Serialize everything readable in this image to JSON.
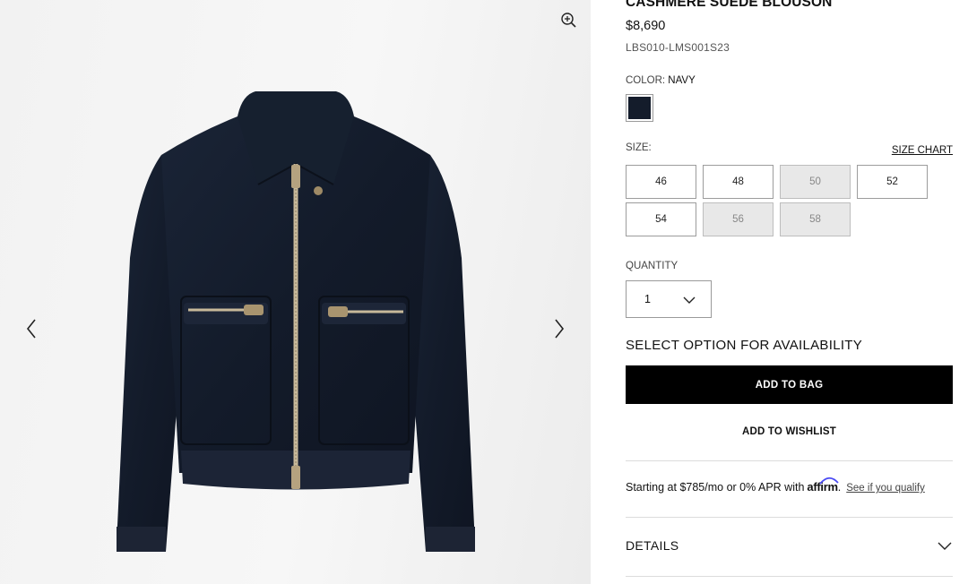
{
  "gallery": {
    "zoom_icon": "zoom-in-icon",
    "prev_icon": "chevron-left-icon",
    "next_icon": "chevron-right-icon",
    "product_color": "#141c2b"
  },
  "product": {
    "title": "CASHMERE SUEDE BLOUSON",
    "price": "$8,690",
    "sku": "LBS010-LMS001S23"
  },
  "color": {
    "label": "COLOR:",
    "selected": "NAVY",
    "swatch_hex": "#141c2b"
  },
  "size": {
    "label": "SIZE:",
    "chart_link": "SIZE CHART",
    "options": [
      {
        "label": "46",
        "available": true
      },
      {
        "label": "48",
        "available": true
      },
      {
        "label": "50",
        "available": false
      },
      {
        "label": "52",
        "available": true
      },
      {
        "label": "54",
        "available": true
      },
      {
        "label": "56",
        "available": false
      },
      {
        "label": "58",
        "available": false
      }
    ]
  },
  "quantity": {
    "label": "QUANTITY",
    "value": "1",
    "icon": "chevron-down-icon"
  },
  "availability_text": "SELECT OPTION FOR AVAILABILITY",
  "actions": {
    "add_to_bag": "ADD TO BAG",
    "add_to_wishlist": "ADD TO WISHLIST"
  },
  "financing": {
    "text": "Starting at $785/mo or 0% APR with",
    "brand": "affirm",
    "period": ".",
    "link": "See if you qualify",
    "brand_color": "#4a4af4"
  },
  "details": {
    "label": "DETAILS",
    "icon": "chevron-down-icon"
  }
}
